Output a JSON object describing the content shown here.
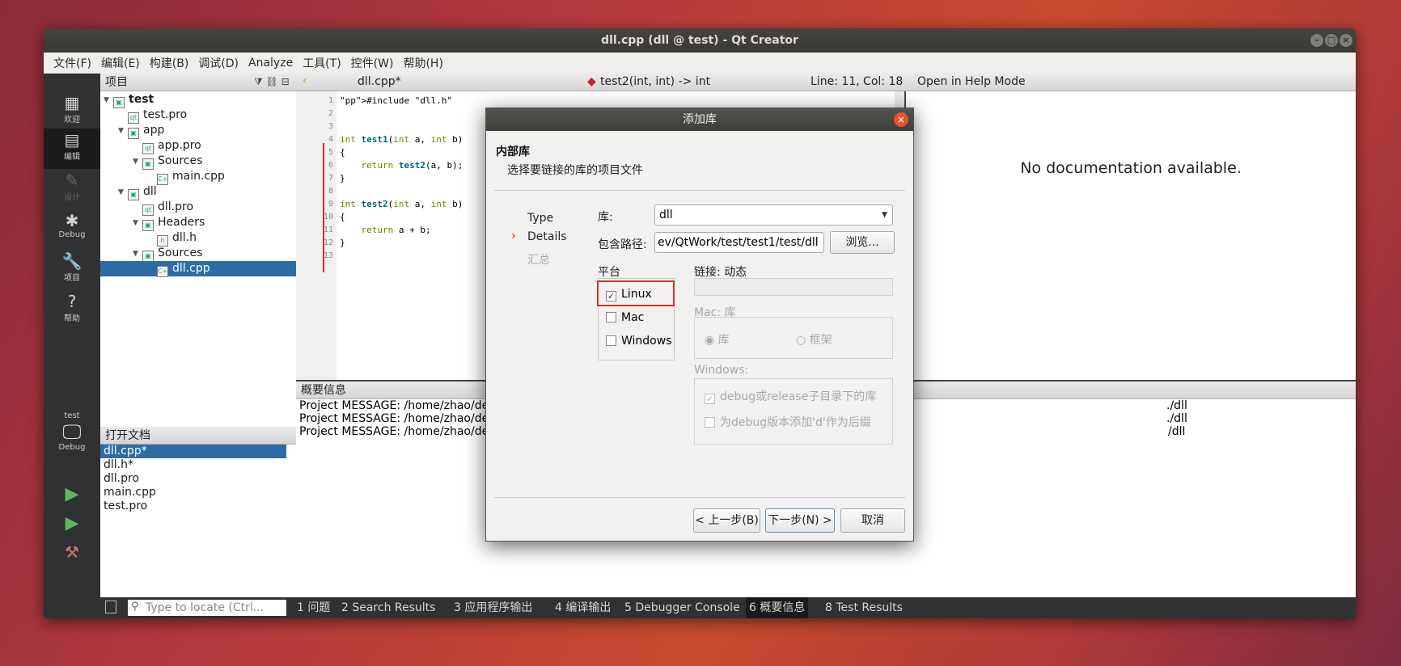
{
  "window": {
    "title": "dll.cpp (dll @ test) - Qt Creator"
  },
  "menubar": [
    "文件(F)",
    "编辑(E)",
    "构建(B)",
    "调试(D)",
    "Analyze",
    "工具(T)",
    "控件(W)",
    "帮助(H)"
  ],
  "modes": [
    {
      "label": "欢迎",
      "icon": "grid-icon"
    },
    {
      "label": "编辑",
      "icon": "edit-icon"
    },
    {
      "label": "设计",
      "icon": "pencil-icon"
    },
    {
      "label": "Debug",
      "icon": "bug-icon"
    },
    {
      "label": "项目",
      "icon": "wrench-icon"
    },
    {
      "label": "帮助",
      "icon": "help-icon"
    }
  ],
  "kit": {
    "project": "test",
    "build": "Debug"
  },
  "project_panel": {
    "title": "项目",
    "tree": [
      "test",
      "test.pro",
      "app",
      "app.pro",
      "Sources",
      "main.cpp",
      "dll",
      "dll.pro",
      "Headers",
      "dll.h",
      "Sources",
      "dll.cpp"
    ]
  },
  "open_docs": {
    "title": "打开文档",
    "items": [
      "dll.cpp*",
      "dll.h*",
      "dll.pro",
      "main.cpp",
      "test.pro"
    ]
  },
  "editor": {
    "file": "dll.cpp*",
    "symbol": "test2(int, int) -> int",
    "position": "Line: 11, Col: 18",
    "line_numbers": [
      "1",
      "2",
      "3",
      "4",
      "5",
      "6",
      "7",
      "8",
      "9",
      "10",
      "11",
      "12",
      "13"
    ],
    "lines": [
      "#include \"dll.h\"",
      "",
      "",
      "int test1(int a, int b)",
      "{",
      "    return test2(a, b);",
      "}",
      "",
      "int test2(int a, int b)",
      "{",
      "    return a + b;",
      "}",
      ""
    ]
  },
  "help_panel": {
    "mode": "Open in Help Mode",
    "message": "No documentation available."
  },
  "output_panel": {
    "title": "概要信息",
    "lines": [
      "Project MESSAGE: /home/zhao/de",
      "Project MESSAGE: /home/zhao/de",
      "Project MESSAGE: /home/zhao/de"
    ],
    "right_lines": [
      "./dll",
      "./dll",
      "/dll"
    ]
  },
  "dialog": {
    "title": "添加库",
    "heading": "内部库",
    "subheading": "选择要链接的库的项目文件",
    "steps": [
      "Type",
      "Details",
      "汇总"
    ],
    "library_label": "库:",
    "library_value": "dll",
    "include_label": "包含路径:",
    "include_value": "ev/QtWork/test/test1/test/dll",
    "browse": "浏览...",
    "platform_label": "平台",
    "platforms": [
      {
        "name": "Linux",
        "checked": true
      },
      {
        "name": "Mac",
        "checked": false
      },
      {
        "name": "Windows",
        "checked": false
      }
    ],
    "link_label": "链接: 动态",
    "mac_label": "Mac: 库",
    "mac_options": [
      "库",
      "框架"
    ],
    "windows_label": "Windows:",
    "windows_options": [
      "debug或release子目录下的库",
      "为debug版本添加'd'作为后缀"
    ],
    "back": "< 上一步(B)",
    "next": "下一步(N) >",
    "cancel": "取消"
  },
  "statusbar": {
    "locator_placeholder": "Type to locate (Ctrl...",
    "tabs": [
      "1  问题",
      "2  Search Results",
      "3  应用程序输出",
      "4  编译输出",
      "5  Debugger Console",
      "6  概要信息",
      "8  Test Results"
    ]
  },
  "colors": {
    "selection": "#2e6da4",
    "highlight_border": "#d9302b",
    "close_button": "#e2552a"
  }
}
